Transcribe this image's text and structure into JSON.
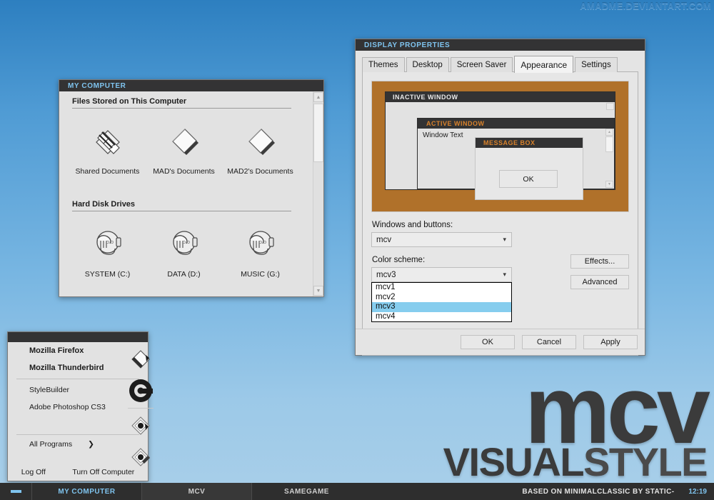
{
  "desktop": {
    "watermark": "AMADME.DEVIANTART.COM",
    "logo_main": "mcv",
    "logo_sub_a": "VISUAL",
    "logo_sub_b": "STYLE",
    "bg_top": "#2d7fc0",
    "bg_bottom": "#a9cfe9"
  },
  "my_computer": {
    "title": "MY COMPUTER",
    "sections": [
      {
        "heading": "Files Stored on This Computer",
        "items": [
          {
            "label": "Shared Documents",
            "icon": "shared-folder-icon"
          },
          {
            "label": "MAD's Documents",
            "icon": "folder-icon"
          },
          {
            "label": "MAD2's Documents",
            "icon": "folder-icon"
          }
        ]
      },
      {
        "heading": "Hard Disk Drives",
        "items": [
          {
            "label": "SYSTEM (C:)",
            "icon": "hard-drive-icon"
          },
          {
            "label": "DATA (D:)",
            "icon": "hard-drive-icon"
          },
          {
            "label": "MUSIC (G:)",
            "icon": "hard-drive-icon"
          }
        ]
      }
    ]
  },
  "display_properties": {
    "title": "DISPLAY PROPERTIES",
    "tabs": [
      {
        "label": "Themes",
        "active": false
      },
      {
        "label": "Desktop",
        "active": false
      },
      {
        "label": "Screen Saver",
        "active": false
      },
      {
        "label": "Appearance",
        "active": true
      },
      {
        "label": "Settings",
        "active": false
      }
    ],
    "preview": {
      "inactive_window_title": "INACTIVE WINDOW",
      "active_window_title": "ACTIVE WINDOW",
      "window_text": "Window Text",
      "message_box_title": "MESSAGE BOX",
      "message_box_button": "OK",
      "desktop_color": "#b0712a",
      "titlebar_color": "#333334",
      "active_title_text_color": "#d9822b",
      "inactive_title_text_color": "#e9e9e9"
    },
    "windows_and_buttons": {
      "label": "Windows and buttons:",
      "value": "mcv"
    },
    "color_scheme": {
      "label": "Color scheme:",
      "value": "mcv3",
      "options": [
        "mcv1",
        "mcv2",
        "mcv3",
        "mcv4"
      ],
      "selected_option": "mcv3",
      "highlight_color": "#86cdee"
    },
    "side_buttons": [
      {
        "label": "Effects..."
      },
      {
        "label": "Advanced"
      }
    ],
    "footer_buttons": [
      {
        "label": "OK"
      },
      {
        "label": "Cancel"
      },
      {
        "label": "Apply"
      }
    ]
  },
  "start_menu": {
    "items": [
      {
        "label": "Mozilla Firefox",
        "bold": true,
        "icon": "firefox-document-icon"
      },
      {
        "label": "Mozilla Thunderbird",
        "bold": true,
        "icon": "thunderbird-icon"
      },
      {
        "label": "StyleBuilder",
        "bold": false,
        "icon": "stylebuilder-icon"
      },
      {
        "label": "Adobe Photoshop CS3",
        "bold": false,
        "icon": "photoshop-icon"
      }
    ],
    "all_programs": "All Programs",
    "all_programs_arrow": "❯",
    "log_off": "Log Off",
    "turn_off": "Turn Off Computer"
  },
  "taskbar": {
    "start_button": "start-button",
    "tasks": [
      {
        "label": "MY COMPUTER",
        "active": true
      },
      {
        "label": "MCV",
        "active": false
      },
      {
        "label": "SAMEGAME",
        "active": false
      }
    ],
    "note": "BASED ON MINIMALCLASSIC BY STATIC-",
    "clock": "12:19"
  }
}
